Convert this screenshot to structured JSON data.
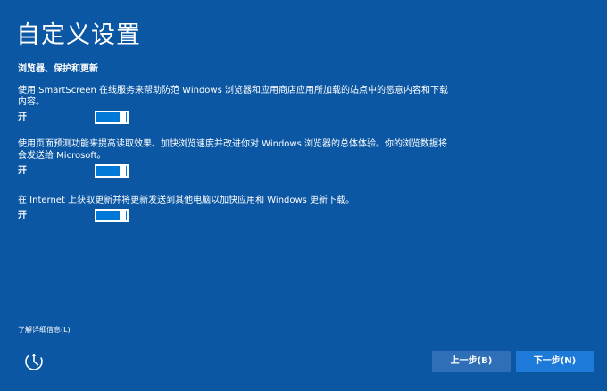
{
  "page": {
    "title": "自定义设置"
  },
  "section": {
    "heading": "浏览器、保护和更新"
  },
  "settings": [
    {
      "description": "使用 SmartScreen 在线服务来帮助防范 Windows 浏览器和应用商店应用所加载的站点中的恶意内容和下载内容。",
      "toggle_label": "开",
      "on": true
    },
    {
      "description": "使用页面预测功能来提高读取效果、加快浏览速度并改进你对 Windows 浏览器的总体体验。你的浏览数据将会发送给 Microsoft。",
      "toggle_label": "开",
      "on": true
    },
    {
      "description": "在 Internet 上获取更新并将更新发送到其他电脑以加快应用和 Windows 更新下载。",
      "toggle_label": "开",
      "on": true
    }
  ],
  "footer": {
    "learn_more": "了解详细信息(L)",
    "accessibility_icon": "ease-of-access-icon",
    "back_label": "上一步(B)",
    "next_label": "下一步(N)"
  },
  "colors": {
    "background": "#0b57a4",
    "toggle_on": "#0078d7",
    "button": "#1e7bd7"
  }
}
